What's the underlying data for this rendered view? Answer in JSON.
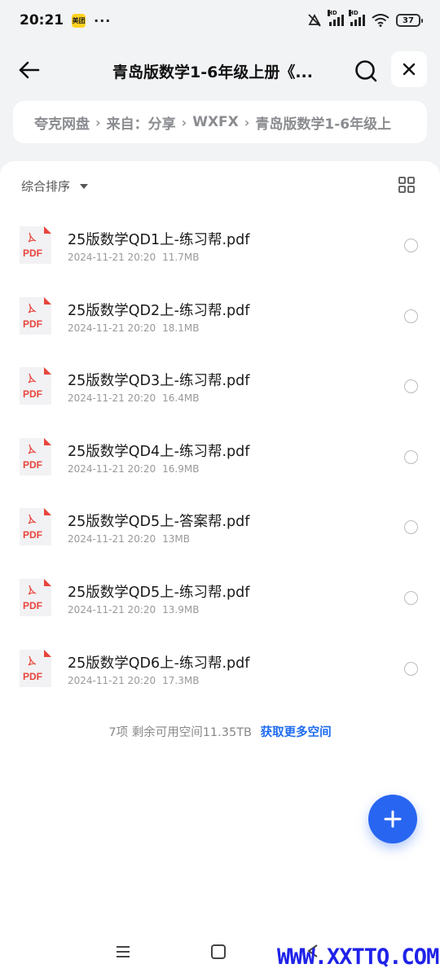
{
  "status_bar": {
    "time": "20:21",
    "app_badge": "美团",
    "more_dots": "···",
    "hd1": "HD",
    "hd2": "HD",
    "battery": "37"
  },
  "header": {
    "title": "青岛版数学1-6年级上册《...",
    "icons": {
      "back": "arrow-left-icon",
      "search": "search-icon",
      "close": "close-icon"
    }
  },
  "breadcrumb": {
    "items": [
      "夸克网盘",
      "来自：分享",
      "WXFX",
      "青岛版数学1-6年级上"
    ],
    "separator": "›"
  },
  "sort": {
    "label": "综合排序"
  },
  "files": [
    {
      "name": "25版数学QD1上-练习帮.pdf",
      "date": "2024-11-21 20:20",
      "size": "11.7MB"
    },
    {
      "name": "25版数学QD2上-练习帮.pdf",
      "date": "2024-11-21 20:20",
      "size": "18.1MB"
    },
    {
      "name": "25版数学QD3上-练习帮.pdf",
      "date": "2024-11-21 20:20",
      "size": "16.4MB"
    },
    {
      "name": "25版数学QD4上-练习帮.pdf",
      "date": "2024-11-21 20:20",
      "size": "16.9MB"
    },
    {
      "name": "25版数学QD5上-答案帮.pdf",
      "date": "2024-11-21 20:20",
      "size": "13MB"
    },
    {
      "name": "25版数学QD5上-练习帮.pdf",
      "date": "2024-11-21 20:20",
      "size": "13.9MB"
    },
    {
      "name": "25版数学QD6上-练习帮.pdf",
      "date": "2024-11-21 20:20",
      "size": "17.3MB"
    }
  ],
  "pdf_label": "PDF",
  "footer": {
    "summary": "7项 剩余可用空间11.35TB",
    "get_more": "获取更多空间"
  },
  "watermark": "WWW.XXTTQ.COM",
  "colors": {
    "accent": "#2866f2",
    "link": "#1f6cf0",
    "pdf_red": "#e8453c",
    "watermark": "#1f22e8"
  }
}
